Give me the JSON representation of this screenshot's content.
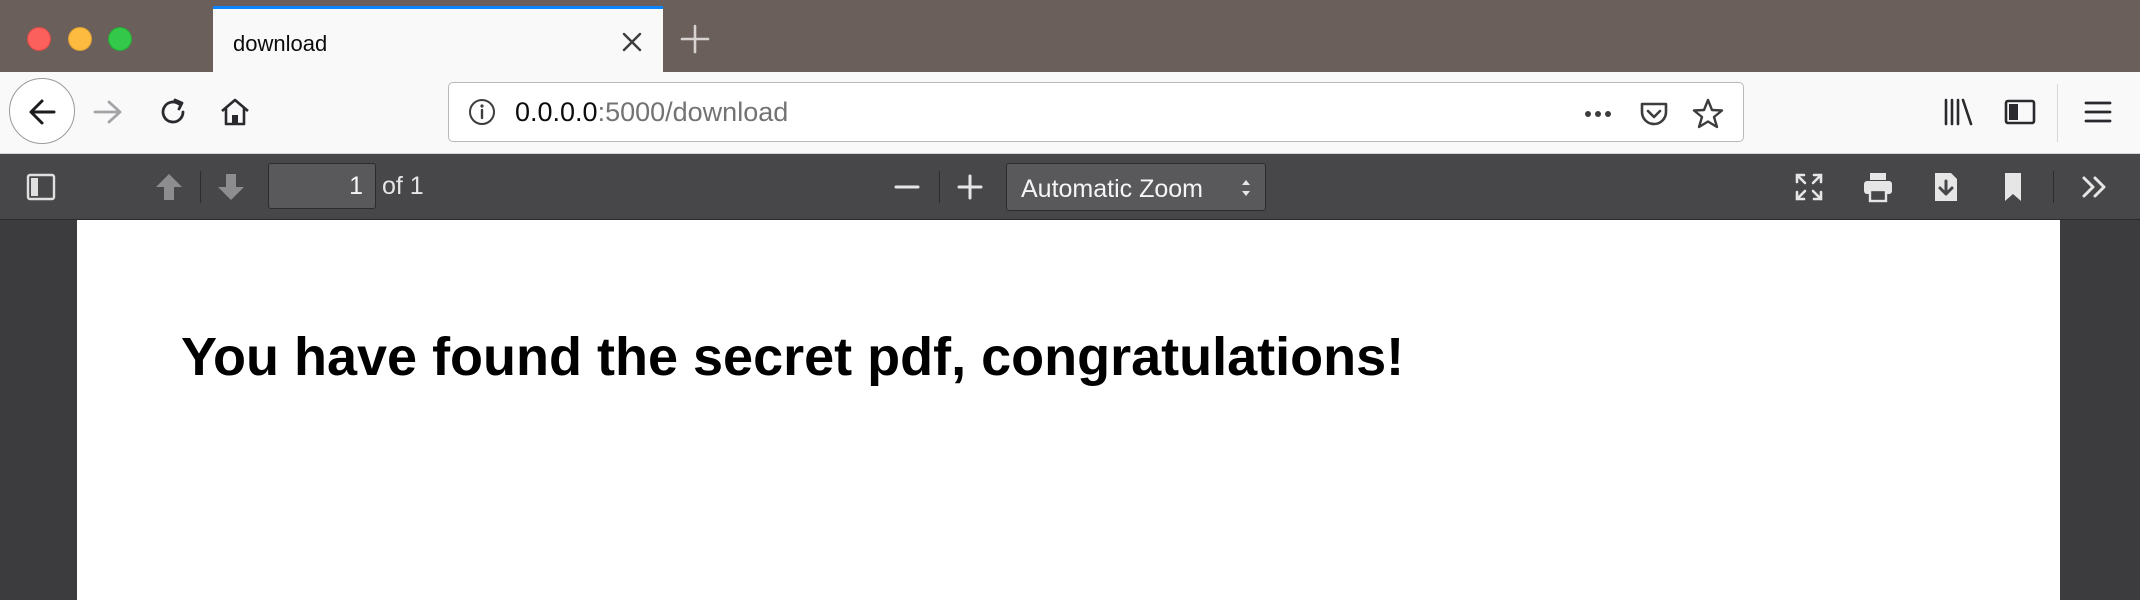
{
  "window": {
    "tab": {
      "title": "download"
    }
  },
  "navbar": {
    "url": {
      "host": "0.0.0.0",
      "rest": ":5000/download"
    }
  },
  "pdf_toolbar": {
    "page_number": "1",
    "page_count_label": "of 1",
    "zoom_label": "Automatic Zoom"
  },
  "document": {
    "heading": "You have found the secret pdf, congratulations!"
  },
  "colors": {
    "tab_accent": "#0a84ff",
    "titlebar": "#6a5f5b",
    "pdf_toolbar": "#474749",
    "viewer_bg": "#3c3c3e"
  }
}
